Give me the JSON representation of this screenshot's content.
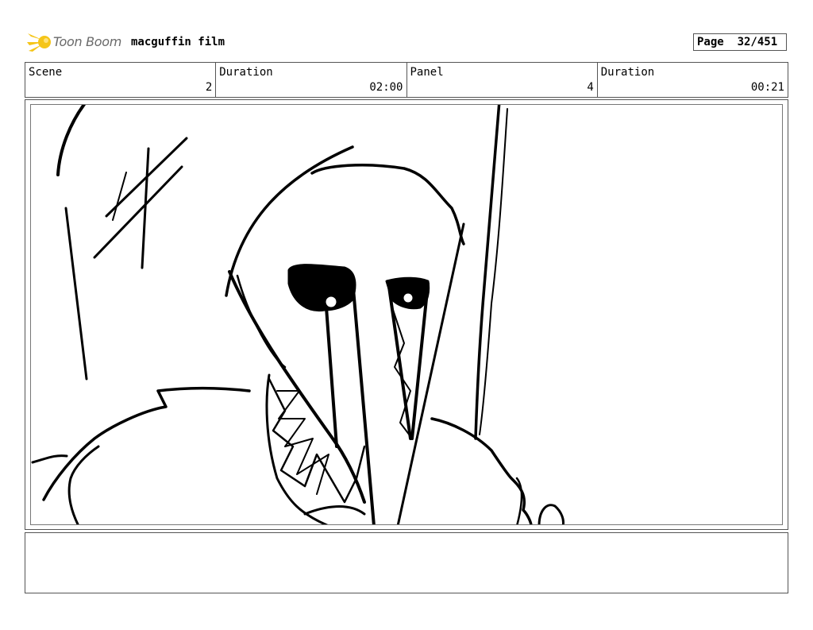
{
  "header": {
    "brand": "Toon Boom",
    "project_title": "macguffin film",
    "page_label": "Page",
    "page_number": "32/451",
    "logo_color": "#f5c518"
  },
  "info": [
    {
      "label": "Scene",
      "value": "2"
    },
    {
      "label": "Duration",
      "value": "02:00"
    },
    {
      "label": "Panel",
      "value": "4"
    },
    {
      "label": "Duration",
      "value": "00:21"
    }
  ],
  "notes": {
    "text": ""
  }
}
